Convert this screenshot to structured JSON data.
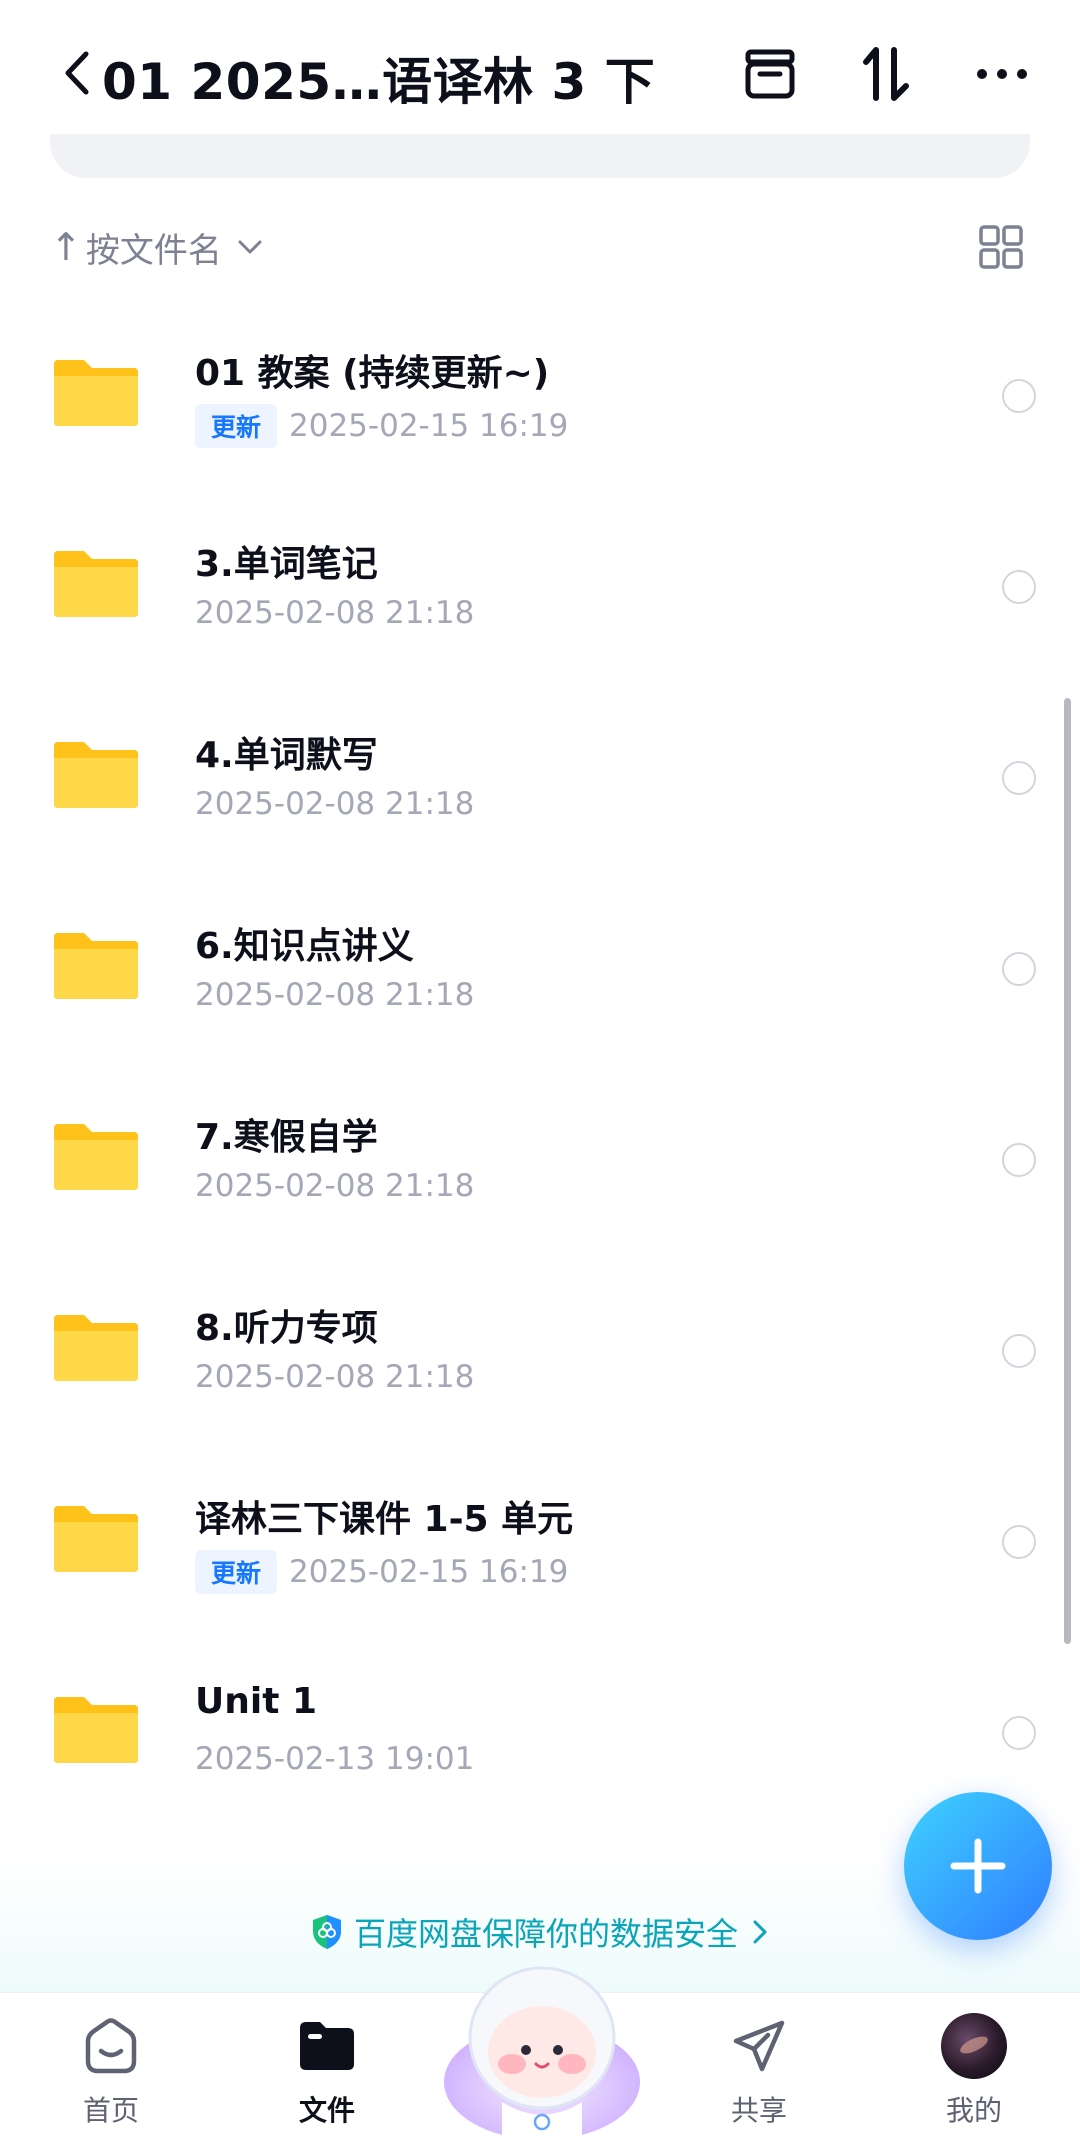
{
  "header": {
    "title": "01 2025…语译林 3 下"
  },
  "sort": {
    "label": "按文件名",
    "arrow": "↑"
  },
  "files": [
    {
      "name": "01 教案 (持续更新~)",
      "badge": "更新",
      "date": "2025-02-15 16:19"
    },
    {
      "name": "3.单词笔记",
      "badge": "",
      "date": "2025-02-08 21:18"
    },
    {
      "name": "4.单词默写",
      "badge": "",
      "date": "2025-02-08 21:18"
    },
    {
      "name": "6.知识点讲义",
      "badge": "",
      "date": "2025-02-08 21:18"
    },
    {
      "name": "7.寒假自学",
      "badge": "",
      "date": "2025-02-08 21:18"
    },
    {
      "name": "8.听力专项",
      "badge": "",
      "date": "2025-02-08 21:18"
    },
    {
      "name": "译林三下课件 1-5 单元",
      "badge": "更新",
      "date": "2025-02-15 16:19"
    },
    {
      "name": "Unit 1",
      "badge": "",
      "date": "2025-02-13 19:01"
    }
  ],
  "security": {
    "text": "百度网盘保障你的数据安全"
  },
  "tabs": {
    "home": "首页",
    "files": "文件",
    "share": "共享",
    "me": "我的"
  },
  "colors": {
    "accent": "#1677ff",
    "folder": "#ffce2e",
    "security": "#0aa5b8",
    "fab_start": "#3fd2ff",
    "fab_end": "#2f7dff"
  },
  "icons": [
    "back-icon",
    "archive-icon",
    "sort-icon",
    "more-icon",
    "chevron-down-icon",
    "grid-view-icon",
    "folder-icon",
    "plus-icon",
    "shield-icon",
    "chevron-right-icon",
    "home-icon",
    "files-icon",
    "share-icon"
  ]
}
